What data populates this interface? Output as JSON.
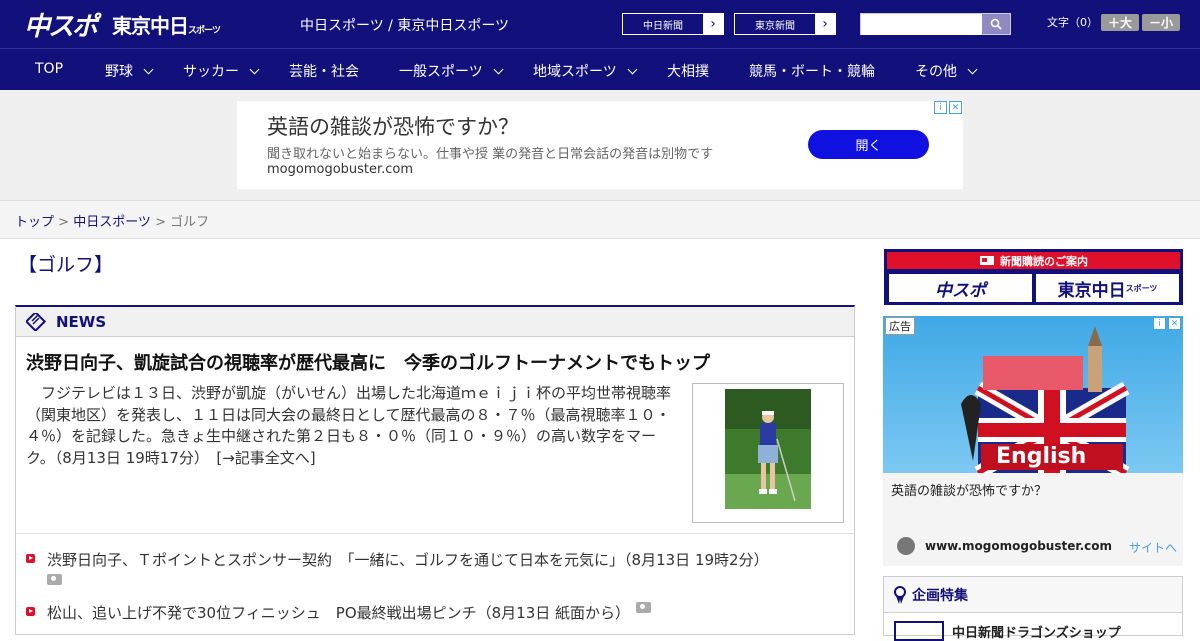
{
  "header": {
    "logo_chuspo": "中スポ",
    "logo_tokyo": "東京中日",
    "logo_tokyo_sub": "スポーツ",
    "sites": "中日スポーツ / 東京中日スポーツ",
    "paper_chunichi": "中日新聞",
    "paper_tokyo": "東京新聞",
    "font_label": "文字（0）",
    "font_plus": "＋大",
    "font_minus": "－小",
    "search_placeholder": ""
  },
  "nav": [
    {
      "label": "TOP"
    },
    {
      "label": "野球"
    },
    {
      "label": "サッカー"
    },
    {
      "label": "芸能・社会"
    },
    {
      "label": "一般スポーツ"
    },
    {
      "label": "地域スポーツ"
    },
    {
      "label": "大相撲"
    },
    {
      "label": "競馬・ボート・競輪"
    },
    {
      "label": "その他"
    }
  ],
  "top_ad": {
    "headline": "英語の雑談が恐怖ですか？",
    "sub": "聞き取れないと始まらない。仕事や授 業の発音と日常会話の発音は別物です",
    "url": "mogomogobuster.com",
    "button": "開く"
  },
  "breadcrumb": {
    "top": "トップ",
    "sep1": " > ",
    "section": "中日スポーツ",
    "sep2": " > ",
    "current": "ゴルフ"
  },
  "page_title": "【ゴルフ】",
  "news": {
    "header": "NEWS",
    "lead_title": "渋野日向子、凱旋試合の視聴率が歴代最高に　今季のゴルフトーナメントでもトップ",
    "lead_body": "フジテレビは１３日、渋野が凱旋（がいせん）出場した北海道ｍｅｉｊｉ杯の平均世帯視聴率（関東地区）を発表し、１１日は同大会の最終日として歴代最高の８・７％（最高視聴率１０・４％）を記録した。急きょ生中継された第２日も８・０％（同１０・９％）の高い数字をマーク。（8月13日 19時17分）　[→記事全文へ]",
    "items": [
      {
        "text": "渋野日向子、Ｔポイントとスポンサー契約　「一緒に、ゴルフを通じて日本を元気に」（8月13日 19時2分）"
      },
      {
        "text": "松山、追い上げ不発で30位フィニッシュ　PO最終戦出場ピンチ（8月13日 紙面から）"
      }
    ]
  },
  "sidebar": {
    "subscribe_label": "新聞購読のご案内",
    "sub_chuspo": "中スポ",
    "sub_tokyo": "東京中日",
    "sub_tokyo_small": "スポーツ",
    "ad_tag": "広告",
    "ad_img_text": "English",
    "ad_text": "英語の雑談が恐怖ですか？",
    "ad_url": "www.mogomogobuster.com",
    "ad_site": "サイトへ",
    "kikaku_title": "企画特集",
    "kikaku_item": "中日新聞ドラゴンズショップ"
  },
  "colors": {
    "brand": "#12107a",
    "accent_red": "#e0102a",
    "ad_button": "#1010e0"
  }
}
